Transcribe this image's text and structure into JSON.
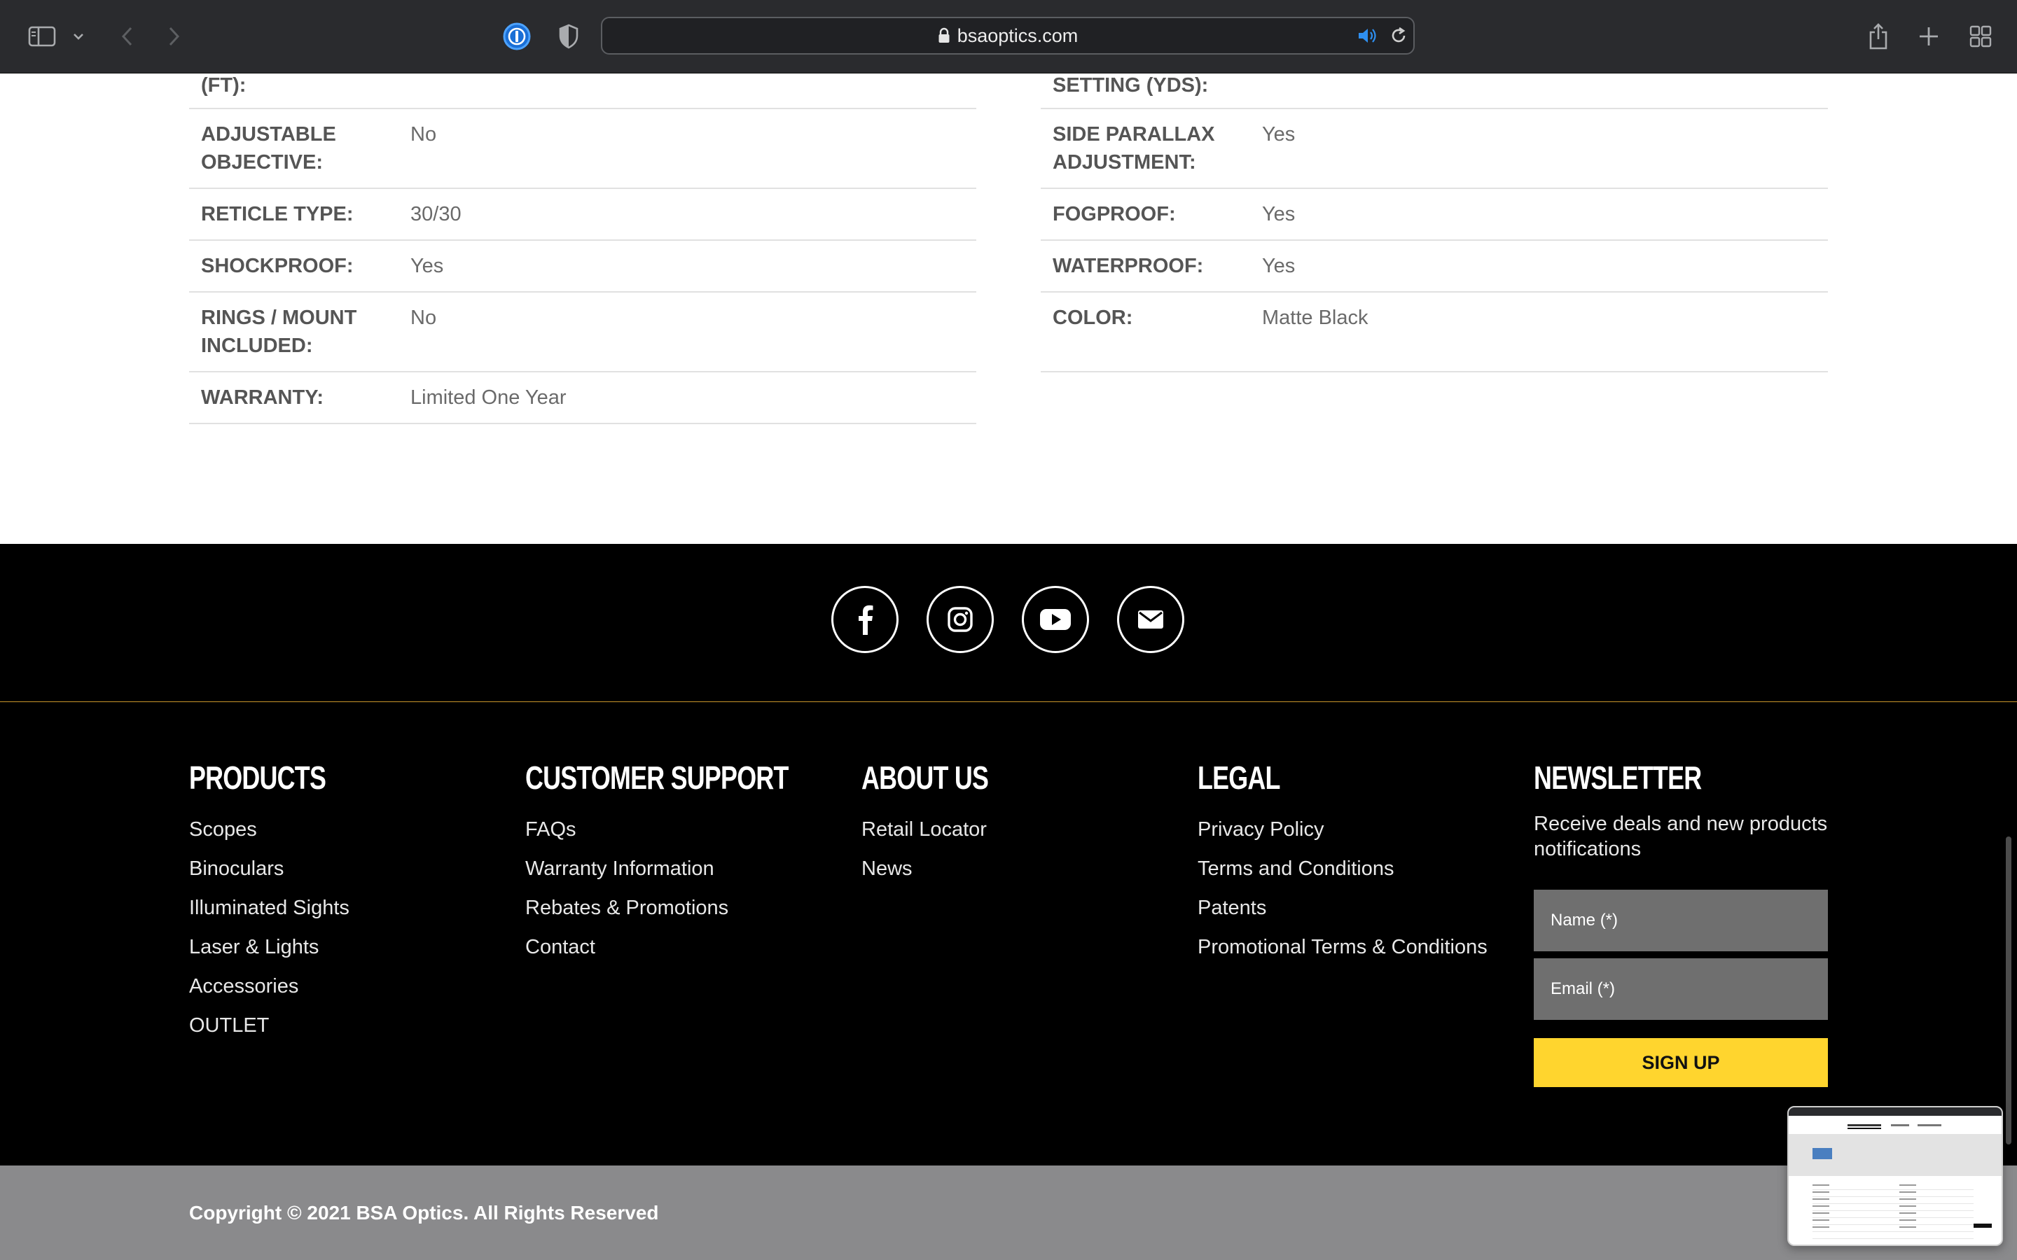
{
  "browser": {
    "url": "bsaoptics.com",
    "icons": [
      "sidebar-icon",
      "chevron-down-icon",
      "back-icon",
      "forward-icon",
      "password-manager-icon",
      "privacy-shield-icon",
      "lock-icon",
      "speaker-icon",
      "reload-icon",
      "share-icon",
      "new-tab-icon",
      "tab-overview-icon"
    ]
  },
  "specs": {
    "left": [
      {
        "label": "(FT):",
        "value": ""
      },
      {
        "label": "ADJUSTABLE OBJECTIVE:",
        "value": "No"
      },
      {
        "label": "RETICLE TYPE:",
        "value": "30/30"
      },
      {
        "label": "SHOCKPROOF:",
        "value": "Yes"
      },
      {
        "label": "RINGS / MOUNT INCLUDED:",
        "value": "No"
      },
      {
        "label": "WARRANTY:",
        "value": "Limited One Year"
      }
    ],
    "right": [
      {
        "label": "SETTING (YDS):",
        "value": ""
      },
      {
        "label": "SIDE PARALLAX ADJUSTMENT:",
        "value": "Yes"
      },
      {
        "label": "FOGPROOF:",
        "value": "Yes"
      },
      {
        "label": "WATERPROOF:",
        "value": "Yes"
      },
      {
        "label": "COLOR:",
        "value": "Matte Black"
      }
    ]
  },
  "social": [
    "facebook-icon",
    "instagram-icon",
    "youtube-icon",
    "email-icon"
  ],
  "footer": {
    "products": {
      "heading": "PRODUCTS",
      "links": [
        "Scopes",
        "Binoculars",
        "Illuminated Sights",
        "Laser & Lights",
        "Accessories",
        "OUTLET"
      ]
    },
    "support": {
      "heading": "CUSTOMER SUPPORT",
      "links": [
        "FAQs",
        "Warranty Information",
        "Rebates & Promotions",
        "Contact"
      ]
    },
    "about": {
      "heading": "ABOUT US",
      "links": [
        "Retail Locator",
        "News"
      ]
    },
    "legal": {
      "heading": "LEGAL",
      "links": [
        "Privacy Policy",
        "Terms and Conditions",
        "Patents",
        "Promotional Terms & Conditions"
      ]
    },
    "newsletter": {
      "heading": "NEWSLETTER",
      "text": "Receive deals and new products notifications",
      "name_placeholder": "Name (*)",
      "email_placeholder": "Email (*)",
      "button": "SIGN UP"
    }
  },
  "copyright": "Copyright © 2021 BSA Optics. All Rights Reserved",
  "colors": {
    "accent": "#ffd52e",
    "divider": "#c8962a",
    "footer_bg": "#000000",
    "copyright_bg": "#8a8a8c"
  }
}
